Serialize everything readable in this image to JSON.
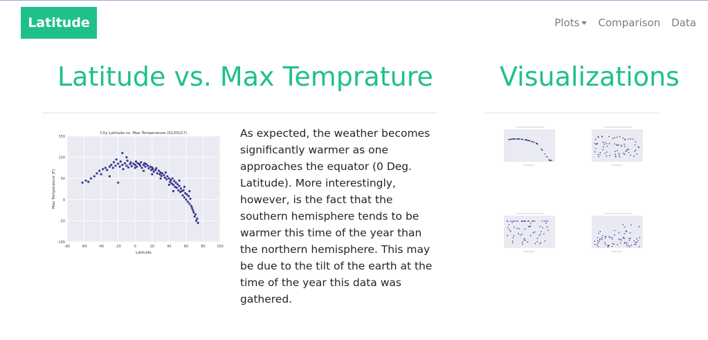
{
  "navbar": {
    "brand": "Latitude",
    "items": [
      {
        "label": "Plots",
        "dropdown": true
      },
      {
        "label": "Comparison",
        "dropdown": false
      },
      {
        "label": "Data",
        "dropdown": false
      }
    ]
  },
  "main": {
    "title": "Latitude vs. Max Temprature",
    "description": "As expected, the weather becomes significantly warmer as one approaches the equator (0 Deg. Latitude). More interestingly, however, is the fact that the southern hemisphere tends to be warmer this time of the year than the northern hemisphere. This may be due to the tilt of the earth at the time of the year this data was gathered."
  },
  "sidebar": {
    "title": "Visualizations"
  },
  "colors": {
    "accent": "#20c08a",
    "plot_background": "#eaeaf2",
    "point": "#1a1a80",
    "nav_text": "#7d7d7d"
  },
  "chart_data": {
    "type": "scatter",
    "title": "City Latitude vs. Max Temperature (01/05/17)",
    "xlabel": "Latitude",
    "ylabel": "Max Temperature (F)",
    "xlim": [
      -80,
      100
    ],
    "ylim": [
      -100,
      150
    ],
    "xticks": [
      -80,
      -60,
      -40,
      -20,
      0,
      20,
      40,
      60,
      80,
      100
    ],
    "yticks": [
      -100,
      -50,
      0,
      50,
      100,
      150
    ],
    "grid": true,
    "series": [
      {
        "points": [
          [
            -62,
            40
          ],
          [
            -58,
            45
          ],
          [
            -55,
            42
          ],
          [
            -52,
            50
          ],
          [
            -48,
            55
          ],
          [
            -45,
            62
          ],
          [
            -42,
            68
          ],
          [
            -40,
            60
          ],
          [
            -38,
            72
          ],
          [
            -35,
            75
          ],
          [
            -33,
            70
          ],
          [
            -30,
            78
          ],
          [
            -28,
            82
          ],
          [
            -26,
            75
          ],
          [
            -25,
            88
          ],
          [
            -23,
            80
          ],
          [
            -22,
            95
          ],
          [
            -20,
            85
          ],
          [
            -18,
            78
          ],
          [
            -17,
            90
          ],
          [
            -15,
            82
          ],
          [
            -14,
            72
          ],
          [
            -12,
            86
          ],
          [
            -10,
            80
          ],
          [
            -9,
            92
          ],
          [
            -8,
            76
          ],
          [
            -6,
            84
          ],
          [
            -5,
            88
          ],
          [
            -4,
            79
          ],
          [
            -2,
            85
          ],
          [
            0,
            82
          ],
          [
            1,
            90
          ],
          [
            2,
            78
          ],
          [
            3,
            86
          ],
          [
            5,
            84
          ],
          [
            6,
            80
          ],
          [
            7,
            88
          ],
          [
            8,
            75
          ],
          [
            10,
            82
          ],
          [
            11,
            86
          ],
          [
            12,
            78
          ],
          [
            13,
            84
          ],
          [
            15,
            80
          ],
          [
            16,
            74
          ],
          [
            18,
            78
          ],
          [
            19,
            70
          ],
          [
            20,
            76
          ],
          [
            21,
            72
          ],
          [
            22,
            66
          ],
          [
            24,
            70
          ],
          [
            25,
            74
          ],
          [
            26,
            62
          ],
          [
            28,
            68
          ],
          [
            29,
            60
          ],
          [
            30,
            64
          ],
          [
            31,
            56
          ],
          [
            32,
            62
          ],
          [
            34,
            58
          ],
          [
            35,
            52
          ],
          [
            36,
            64
          ],
          [
            37,
            48
          ],
          [
            38,
            55
          ],
          [
            40,
            50
          ],
          [
            41,
            42
          ],
          [
            42,
            46
          ],
          [
            43,
            38
          ],
          [
            44,
            50
          ],
          [
            45,
            35
          ],
          [
            46,
            44
          ],
          [
            47,
            30
          ],
          [
            48,
            40
          ],
          [
            49,
            28
          ],
          [
            50,
            36
          ],
          [
            51,
            22
          ],
          [
            52,
            32
          ],
          [
            53,
            18
          ],
          [
            54,
            26
          ],
          [
            55,
            20
          ],
          [
            56,
            10
          ],
          [
            57,
            22
          ],
          [
            58,
            5
          ],
          [
            59,
            15
          ],
          [
            60,
            0
          ],
          [
            61,
            12
          ],
          [
            62,
            -5
          ],
          [
            63,
            8
          ],
          [
            64,
            -10
          ],
          [
            65,
            2
          ],
          [
            66,
            -15
          ],
          [
            67,
            -20
          ],
          [
            68,
            -25
          ],
          [
            69,
            -30
          ],
          [
            70,
            -40
          ],
          [
            71,
            -35
          ],
          [
            72,
            -50
          ],
          [
            73,
            -45
          ],
          [
            74,
            -55
          ],
          [
            64,
            20
          ],
          [
            58,
            30
          ],
          [
            52,
            45
          ],
          [
            -20,
            40
          ],
          [
            -30,
            55
          ],
          [
            -10,
            100
          ],
          [
            -15,
            110
          ],
          [
            0,
            75
          ],
          [
            10,
            68
          ],
          [
            20,
            60
          ],
          [
            30,
            50
          ],
          [
            40,
            35
          ],
          [
            45,
            20
          ]
        ]
      }
    ]
  },
  "thumbnails": [
    {
      "name": "Max Temperature",
      "type": "scatter"
    },
    {
      "name": "Humidity",
      "type": "scatter"
    },
    {
      "name": "Cloudiness",
      "type": "scatter"
    },
    {
      "name": "Wind Speed",
      "type": "scatter"
    }
  ]
}
